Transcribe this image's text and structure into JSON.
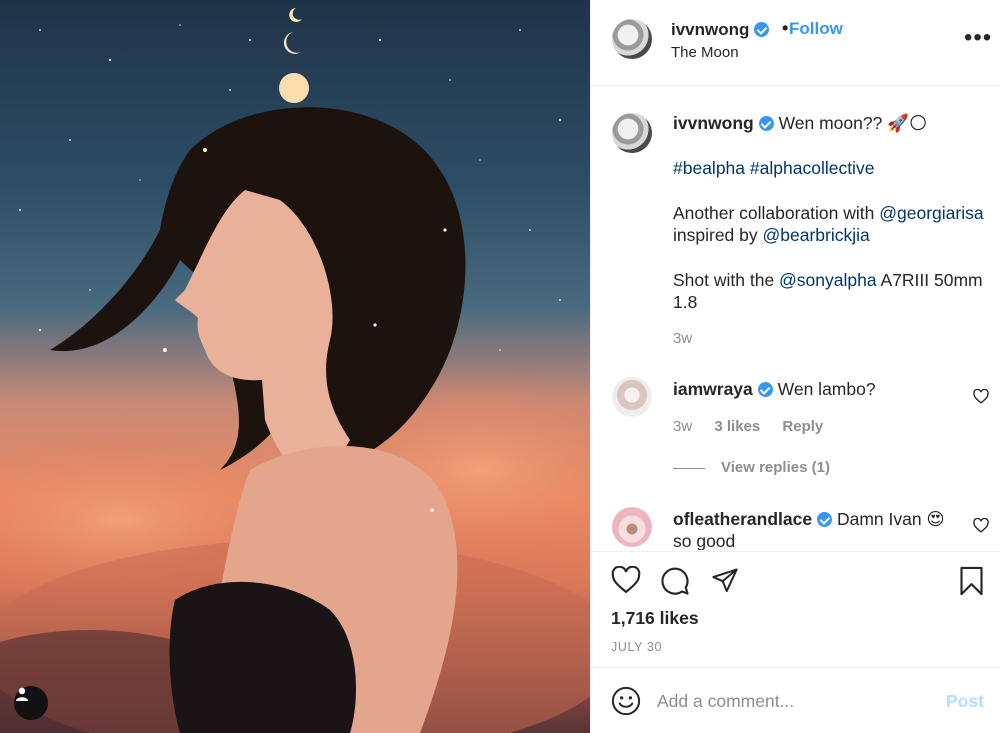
{
  "post": {
    "username": "ivvnwong",
    "follow_label": "Follow",
    "location": "The Moon",
    "more_label": "•••"
  },
  "caption": {
    "username": "ivvnwong",
    "text": "Wen moon?? 🚀🌕",
    "hashtags": [
      "#bealpha",
      "#alphacollective"
    ],
    "line2_prefix": "Another collaboration with",
    "mention1": "@georgiarisa",
    "line2_mid": "inspired by",
    "mention2": "@bearbrickjia",
    "line3_prefix": "Shot with the",
    "mention3": "@sonyalpha",
    "line3_suffix": "A7RIII 50mm 1.8",
    "time": "3w"
  },
  "comments": [
    {
      "username": "iamwraya",
      "text": "Wen lambo?",
      "time": "3w",
      "likes": "3 likes",
      "reply_label": "Reply",
      "view_replies": "View replies (1)"
    },
    {
      "username": "ofleatherandlace",
      "text": "Damn Ivan 😍",
      "text2": "so good"
    }
  ],
  "stats": {
    "likes": "1,716 likes",
    "date": "JULY 30"
  },
  "add_comment": {
    "placeholder": "Add a comment...",
    "post_label": "Post"
  },
  "colors": {
    "link": "#00376b",
    "follow": "#3897f0",
    "muted": "#8e8e8e",
    "post_disabled": "#b2dffc"
  },
  "icons": {
    "verified": "verified-badge-icon",
    "heart": "heart-icon",
    "comment": "comment-icon",
    "share": "share-icon",
    "bookmark": "bookmark-icon",
    "emoji": "emoji-icon",
    "user_tag": "user-tag-icon"
  }
}
